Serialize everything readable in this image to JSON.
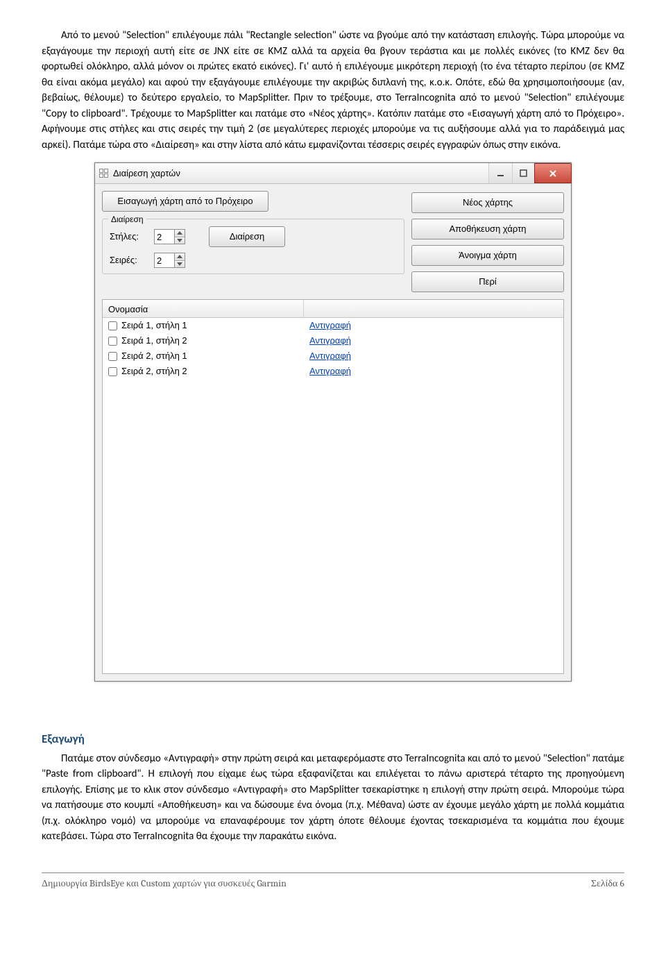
{
  "paragraphs": {
    "p1": "Από το μενού \"Selection\" επιλέγουμε πάλι \"Rectangle selection\" ώστε να βγούμε από την κατάσταση επιλογής. Τώρα μπορούμε να εξαγάγουμε την περιοχή αυτή είτε σε JNX είτε σε KMZ αλλά τα αρχεία θα βγουν τεράστια και με πολλές εικόνες (το KMZ δεν θα φορτωθεί ολόκληρο, αλλά μόνον οι πρώτες εκατό εικόνες). Γι' αυτό ή επιλέγουμε μικρότερη περιοχή (το ένα τέταρτο περίπου (σε KMZ θα είναι ακόμα μεγάλο) και αφού την εξαγάγουμε επιλέγουμε την ακριβώς διπλανή της, κ.ο.κ. Οπότε, εδώ θα χρησιμοποιήσουμε (αν, βεβαίως, θέλουμε) το δεύτερο εργαλείο, το MapSplitter. Πριν το τρέξουμε, στο TerraIncognita από το μενού \"Selection\" επιλέγουμε \"Copy to clipboard\". Τρέχουμε το MapSplitter και πατάμε στο «Νέος χάρτης». Κατόπιν πατάμε στο «Εισαγωγή χάρτη από το Πρόχειρο». Αφήνουμε στις στήλες και στις σειρές την τιμή 2 (σε μεγαλύτερες περιοχές μπορούμε να τις αυξήσουμε αλλά για το παράδειγμά μας αρκεί). Πατάμε τώρα στο «Διαίρεση» και στην λίστα από κάτω εμφανίζονται τέσσερις σειρές εγγραφών όπως στην εικόνα.",
    "export_head": "Εξαγωγή",
    "p2": "Πατάμε στον σύνδεσμο «Αντιγραφή» στην πρώτη σειρά και μεταφερόμαστε στο TerraIncognita και από το μενού \"Selection\" πατάμε \"Paste from clipboard\". Η επιλογή που είχαμε έως τώρα εξαφανίζεται και επιλέγεται το πάνω αριστερά τέταρτο της προηγούμενη επιλογής. Επίσης με το κλικ στον σύνδεσμο «Αντιγραφή» στο MapSplitter τσεκαρίστηκε η επιλογή στην πρώτη σειρά. Μπορούμε τώρα να πατήσουμε στο κουμπί «Αποθήκευση» και να δώσουμε ένα όνομα (π.χ. Μέθανα) ώστε αν έχουμε μεγάλο χάρτη με πολλά κομμάτια (π.χ. ολόκληρο νομό) να μπορούμε να επαναφέρουμε τον χάρτη όποτε θέλουμε έχοντας τσεκαρισμένα τα κομμάτια που έχουμε κατεβάσει. Τώρα στο TerraIncognita θα έχουμε την παρακάτω εικόνα."
  },
  "window": {
    "title": "Διαίρεση χαρτών",
    "import_btn": "Εισαγωγή χάρτη από το Πρόχειρο",
    "new_map_btn": "Νέος χάρτης",
    "save_map_btn": "Αποθήκευση χάρτη",
    "open_map_btn": "Άνοιγμα χάρτη",
    "about_btn": "Περί",
    "group_title": "Διαίρεση",
    "cols_label": "Στήλες:",
    "rows_label": "Σειρές:",
    "cols_value": "2",
    "rows_value": "2",
    "divide_btn": "Διαίρεση",
    "header_name": "Ονομασία",
    "rows": [
      {
        "label": "Σειρά 1, στήλη 1",
        "action": "Αντιγραφή"
      },
      {
        "label": "Σειρά 1, στήλη 2",
        "action": "Αντιγραφή"
      },
      {
        "label": "Σειρά 2, στήλη 1",
        "action": "Αντιγραφή"
      },
      {
        "label": "Σειρά 2, στήλη 2",
        "action": "Αντιγραφή"
      }
    ]
  },
  "footer": {
    "left": "Δημιουργία BirdsEye και Custom χαρτών για συσκευές Garmin",
    "right": "Σελίδα 6"
  }
}
